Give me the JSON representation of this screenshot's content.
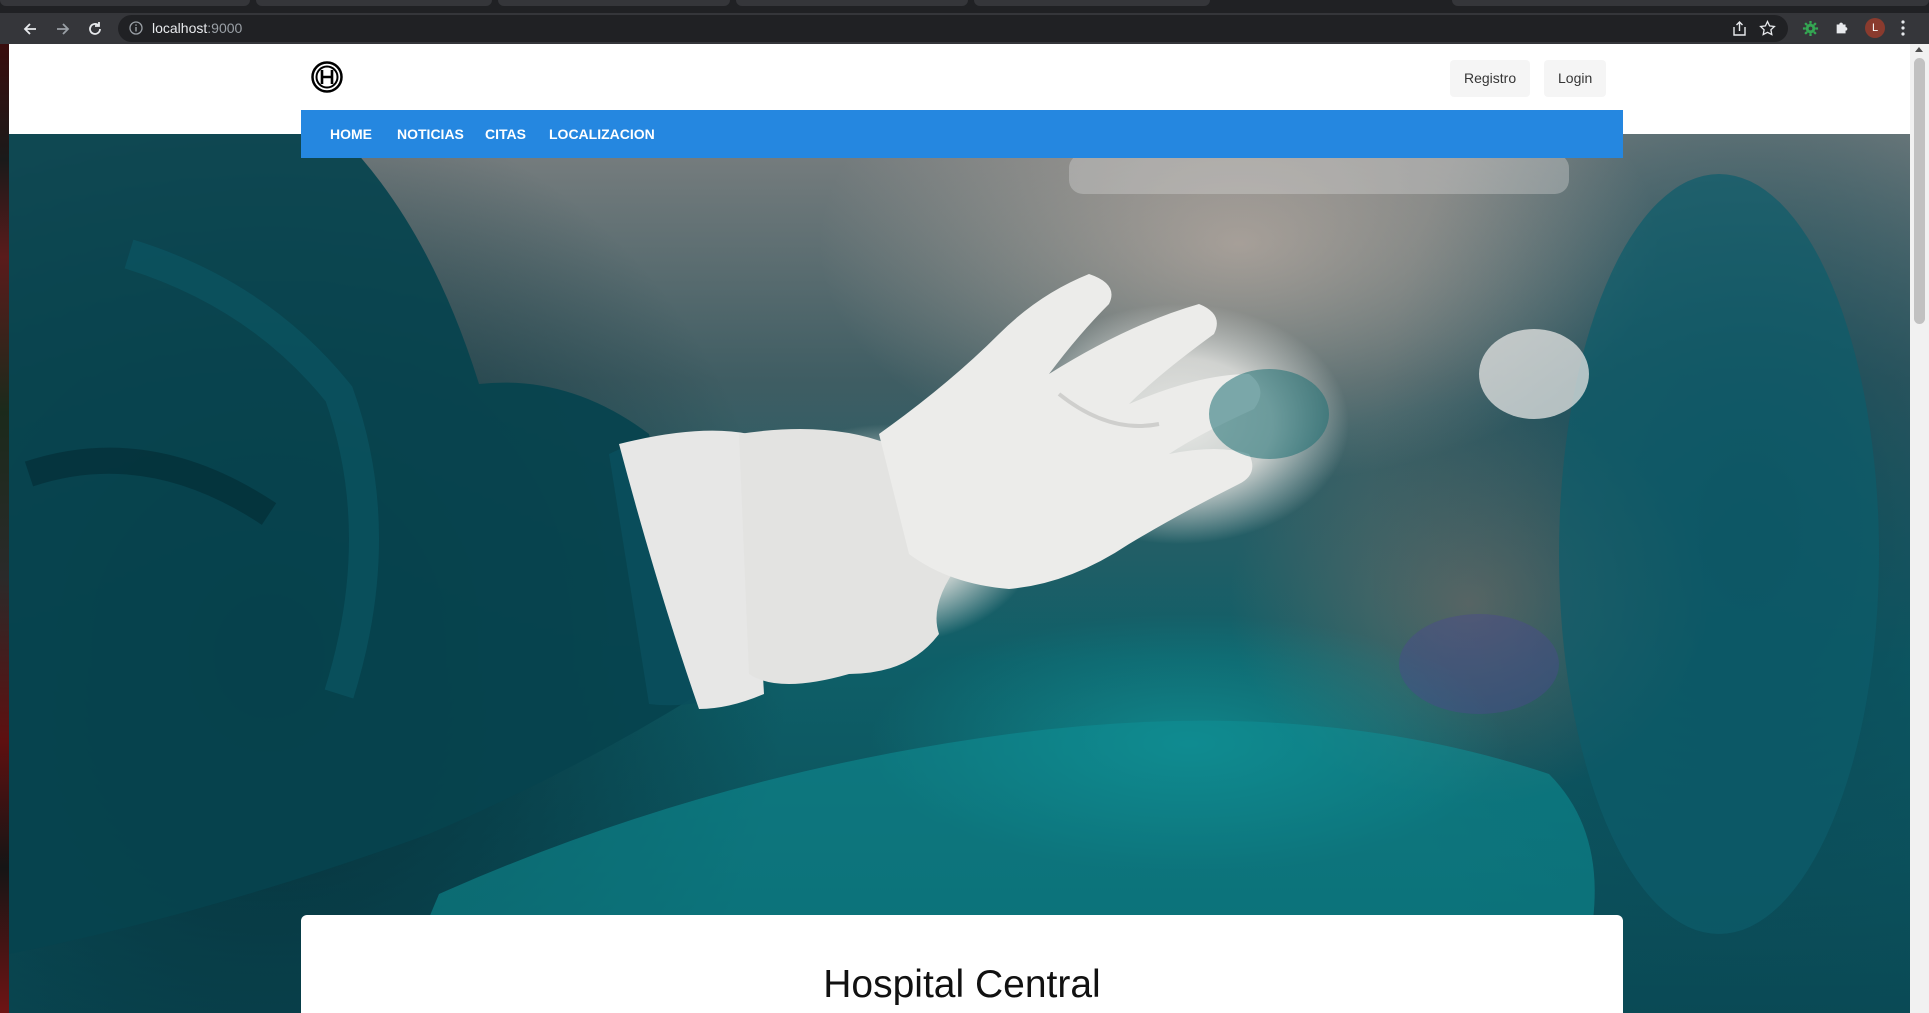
{
  "browser": {
    "url_host": "localhost",
    "url_port": ":9000",
    "profile_initial": "L"
  },
  "header": {
    "logo_icon": "hospital-h-logo",
    "register_label": "Registro",
    "login_label": "Login"
  },
  "nav": {
    "items": [
      {
        "label": "HOME"
      },
      {
        "label": "NOTICIAS"
      },
      {
        "label": "CITAS"
      },
      {
        "label": "LOCALIZACION"
      }
    ],
    "color": "#2587e0"
  },
  "card": {
    "title": "Hospital Central"
  }
}
